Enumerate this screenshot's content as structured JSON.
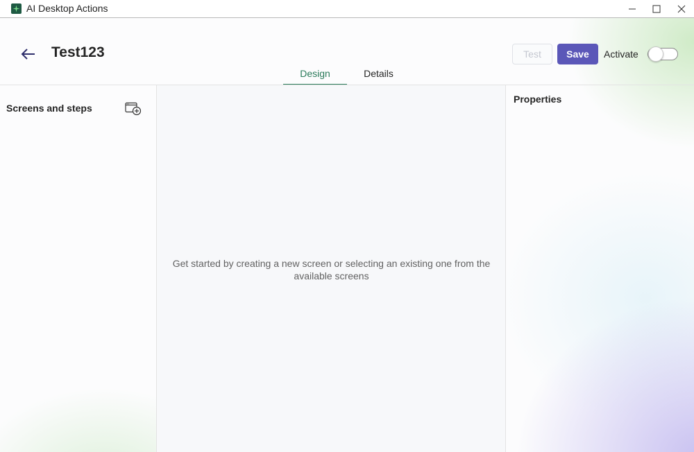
{
  "window": {
    "title": "AI Desktop Actions",
    "minimize_icon": "minimize-icon",
    "maximize_icon": "maximize-icon",
    "close_icon": "close-icon"
  },
  "header": {
    "back_icon": "arrow-left-icon",
    "page_title": "Test123",
    "test_label": "Test",
    "save_label": "Save",
    "activate_label": "Activate",
    "activate_on": false
  },
  "tabs": [
    {
      "label": "Design",
      "selected": true
    },
    {
      "label": "Details",
      "selected": false
    }
  ],
  "left_panel": {
    "title": "Screens and steps",
    "add_icon": "add-screen-icon"
  },
  "center_panel": {
    "empty_message": "Get started by creating a new screen or selecting an existing one from the available screens"
  },
  "right_panel": {
    "title": "Properties"
  },
  "colors": {
    "accent": "#5b57b8",
    "tab_selected": "#2a7a5a",
    "app_icon": "#1e5a43"
  }
}
